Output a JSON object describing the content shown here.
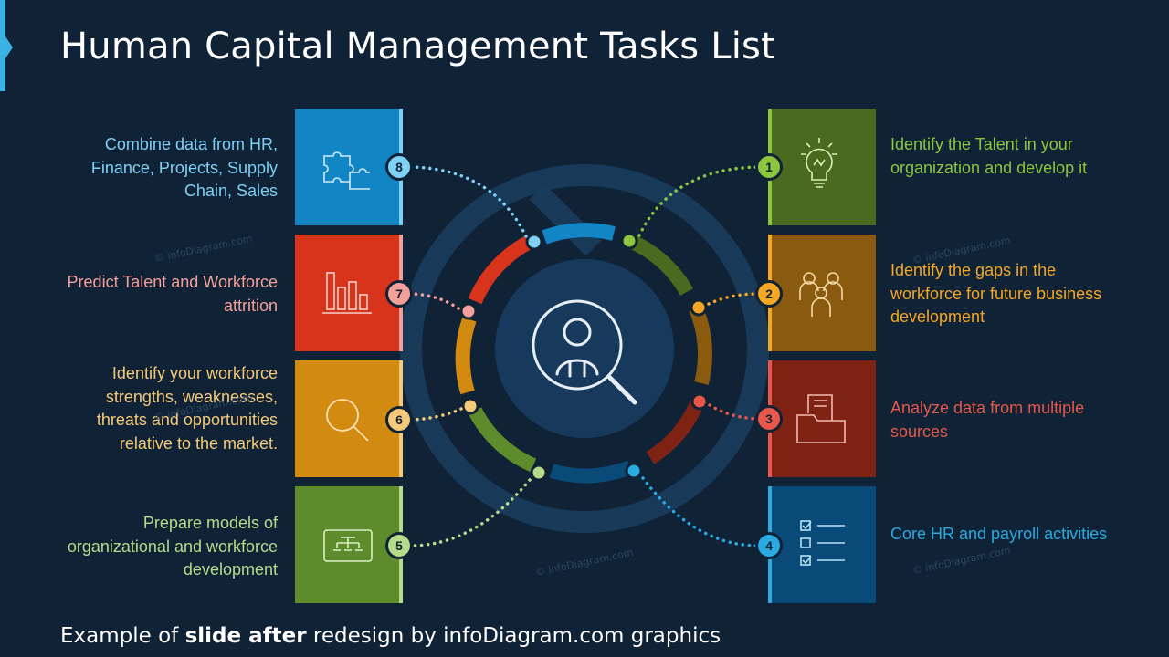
{
  "title": "Human Capital Management Tasks List",
  "footer": {
    "prefix": "Example of ",
    "bold": "slide after",
    "suffix": " redesign by infoDiagram.com graphics"
  },
  "watermark": "© infoDiagram.com",
  "colors": {
    "background": "#0f2236",
    "accent": "#3bb2e3",
    "green_dark": "#4a6a1f",
    "orange_dark": "#8a5a0e",
    "red_dark": "#7e2214",
    "blue_dark": "#0a4a78",
    "blue": "#1286c4",
    "red": "#d8341c",
    "orange": "#d28a10",
    "green": "#5e8b2c"
  },
  "tasks": [
    {
      "number": "1",
      "text": "Identify the Talent in your organization and develop it",
      "color": "#8cc63f",
      "icon": "lightbulb-icon"
    },
    {
      "number": "2",
      "text": "Identify the gaps in the workforce for future business development",
      "color": "#f5a623",
      "icon": "team-icon"
    },
    {
      "number": "3",
      "text": "Analyze data from multiple sources",
      "color": "#e8574a",
      "icon": "folder-icon"
    },
    {
      "number": "4",
      "text": "Core HR and payroll activities",
      "color": "#29abe2",
      "icon": "checklist-icon"
    },
    {
      "number": "5",
      "text": "Prepare models of organizational and workforce development",
      "color": "#b5dc8a",
      "icon": "org-chart-icon"
    },
    {
      "number": "6",
      "text": "Identify your workforce strengths, weaknesses, threats and opportunities relative to the market.",
      "color": "#f5c97a",
      "icon": "magnifier-icon"
    },
    {
      "number": "7",
      "text": "Predict Talent and Workforce attrition",
      "color": "#f4a09a",
      "icon": "bar-chart-icon"
    },
    {
      "number": "8",
      "text": "Combine data from HR, Finance, Projects, Supply Chain, Sales",
      "color": "#7fd0f5",
      "icon": "puzzle-icon"
    }
  ],
  "center_icon": "person-search-icon"
}
